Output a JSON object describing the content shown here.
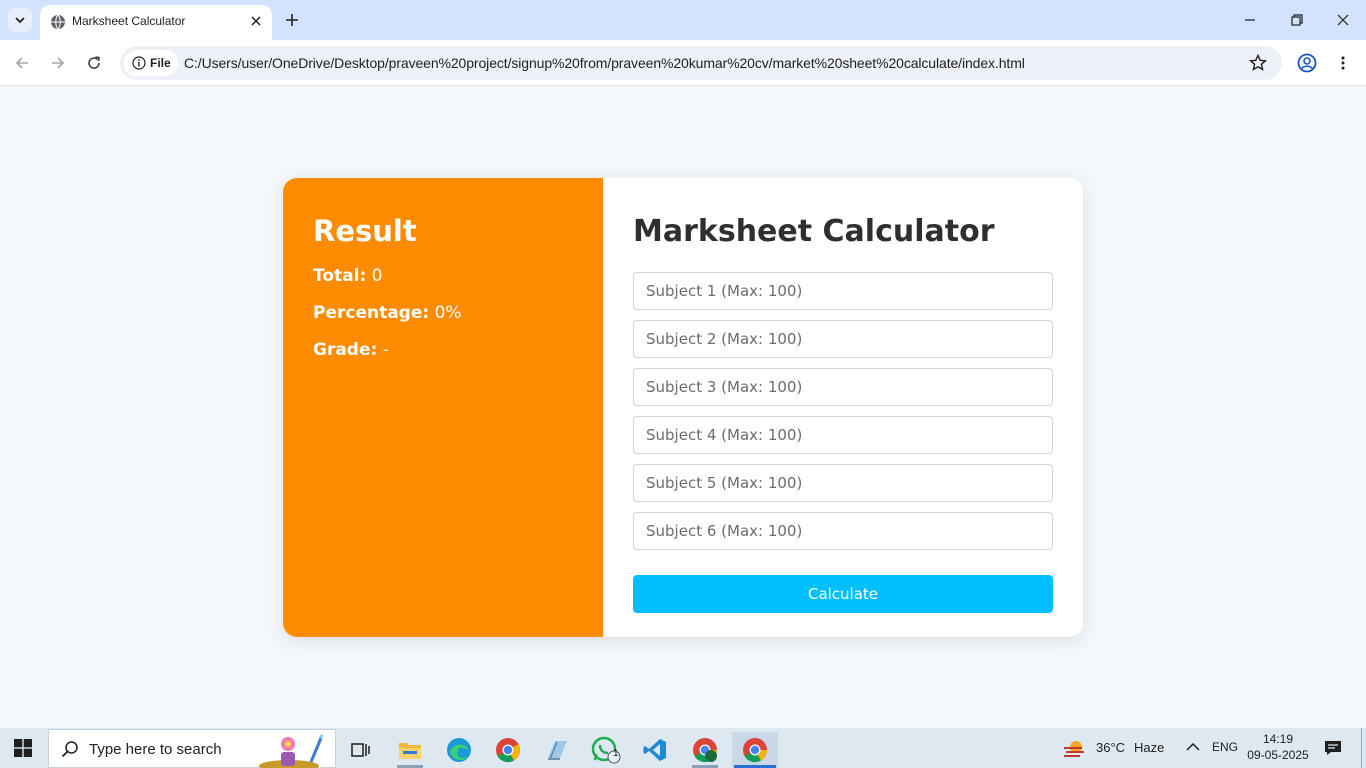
{
  "browser": {
    "tab_title": "Marksheet Calculator",
    "site_chip": "File",
    "url": "C:/Users/user/OneDrive/Desktop/praveen%20project/signup%20from/praveen%20kumar%20cv/market%20sheet%20calculate/index.html"
  },
  "result": {
    "heading": "Result",
    "total_label": "Total:",
    "total_value": "0",
    "percentage_label": "Percentage:",
    "percentage_value": "0%",
    "grade_label": "Grade:",
    "grade_value": "-"
  },
  "form": {
    "heading": "Marksheet Calculator",
    "subjects": [
      {
        "placeholder": "Subject 1 (Max: 100)"
      },
      {
        "placeholder": "Subject 2 (Max: 100)"
      },
      {
        "placeholder": "Subject 3 (Max: 100)"
      },
      {
        "placeholder": "Subject 4 (Max: 100)"
      },
      {
        "placeholder": "Subject 5 (Max: 100)"
      },
      {
        "placeholder": "Subject 6 (Max: 100)"
      }
    ],
    "calculate_label": "Calculate"
  },
  "taskbar": {
    "search_placeholder": "Type here to search",
    "whatsapp_badge": "1",
    "temperature": "36°C",
    "weather": "Haze",
    "language": "ENG",
    "time": "14:19",
    "date": "09-05-2025"
  },
  "colors": {
    "result_panel": "#ff8c00",
    "calculate_button": "#00bfff",
    "page_background": "#f4f8fc"
  }
}
